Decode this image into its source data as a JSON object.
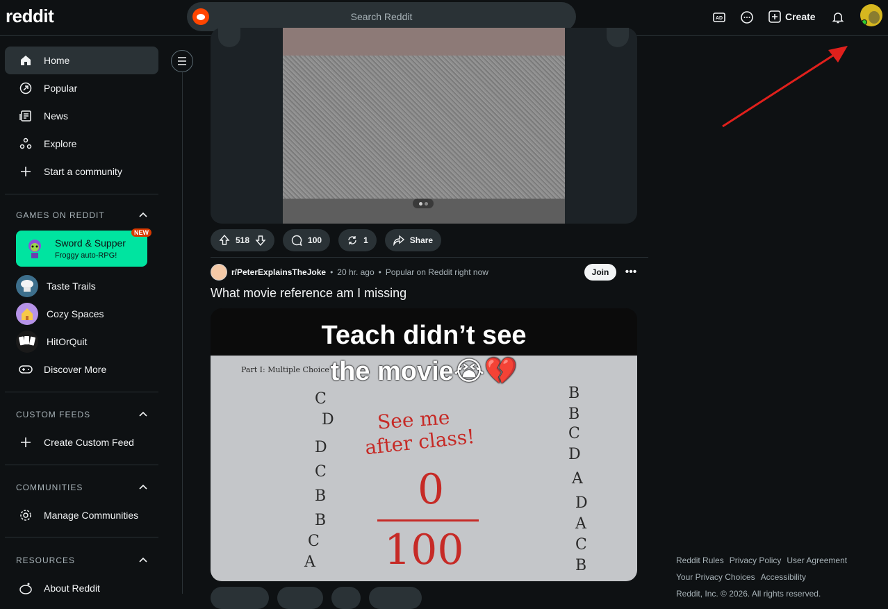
{
  "header": {
    "logo": "reddit",
    "search_placeholder": "Search Reddit",
    "create_label": "Create"
  },
  "sidebar": {
    "nav": [
      {
        "label": "Home",
        "icon": "home-icon",
        "active": true
      },
      {
        "label": "Popular",
        "icon": "popular-icon"
      },
      {
        "label": "News",
        "icon": "news-icon"
      },
      {
        "label": "Explore",
        "icon": "explore-icon"
      },
      {
        "label": "Start a community",
        "icon": "plus-icon"
      }
    ],
    "games": {
      "heading": "GAMES ON REDDIT",
      "featured": {
        "title": "Sword & Supper",
        "subtitle": "Froggy auto-RPG!",
        "badge": "NEW"
      },
      "items": [
        {
          "label": "Taste Trails"
        },
        {
          "label": "Cozy Spaces"
        },
        {
          "label": "HitOrQuit"
        },
        {
          "label": "Discover More"
        }
      ]
    },
    "custom_feeds": {
      "heading": "CUSTOM FEEDS",
      "create_label": "Create Custom Feed"
    },
    "communities": {
      "heading": "COMMUNITIES",
      "manage_label": "Manage Communities"
    },
    "resources": {
      "heading": "RESOURCES",
      "about_label": "About Reddit"
    }
  },
  "post1": {
    "votes": "518",
    "comments": "100",
    "crossposts": "1",
    "share_label": "Share"
  },
  "post2": {
    "subreddit": "r/PeterExplainsTheJoke",
    "time": "20 hr. ago",
    "popular_note": "Popular on Reddit right now",
    "join_label": "Join",
    "title": "What movie reference am I missing",
    "caption_line1": "Teach didn’t see",
    "caption_line2": "the movie😭💔",
    "paper_header": "Part I: Multiple Choice",
    "red_note_line1": "See me",
    "red_note_line2": "after class!",
    "score_top": "0",
    "score_bottom": "100"
  },
  "footer": {
    "links": [
      "Reddit Rules",
      "Privacy Policy",
      "User Agreement",
      "Your Privacy Choices",
      "Accessibility"
    ],
    "copyright": "Reddit, Inc. © 2026. All rights reserved."
  },
  "colors": {
    "accent": "#ff4500",
    "game_card": "#00e4a0",
    "annotation_arrow": "#e0201c"
  }
}
